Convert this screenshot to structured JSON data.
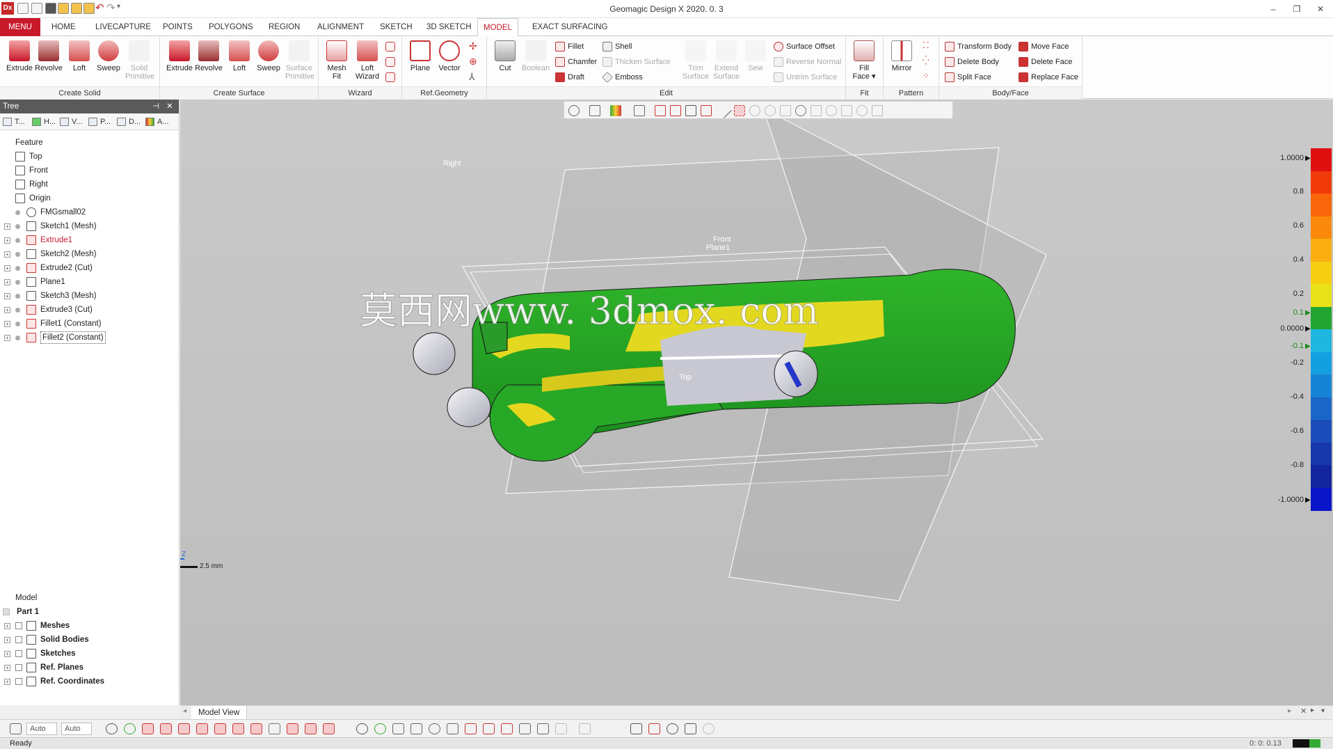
{
  "app": {
    "logo_text": "Dx",
    "window_title": "Geomagic Design X 2020. 0. 3",
    "window_buttons": [
      "–",
      "❐",
      "✕"
    ]
  },
  "tabs": [
    "MENU",
    "HOME",
    "LIVECAPTURE",
    "POINTS",
    "POLYGONS",
    "REGION",
    "ALIGNMENT",
    "SKETCH",
    "3D SKETCH",
    "MODEL",
    "EXACT SURFACING"
  ],
  "active_tab": "MODEL",
  "ribbon": {
    "create_solid": {
      "label": "Create Solid",
      "buttons": [
        "Extrude",
        "Revolve",
        "Loft",
        "Sweep",
        "Solid Primitive"
      ]
    },
    "create_surface": {
      "label": "Create Surface",
      "buttons": [
        "Extrude",
        "Revolve",
        "Loft",
        "Sweep",
        "Surface Primitive"
      ]
    },
    "wizard": {
      "label": "Wizard",
      "buttons": [
        "Mesh Fit",
        "Loft Wizard"
      ]
    },
    "ref_geometry": {
      "label": "Ref.Geometry",
      "buttons": [
        "Plane",
        "Vector"
      ]
    },
    "edit": {
      "label": "Edit",
      "buttons": [
        "Cut",
        "Boolean"
      ],
      "small": [
        "Fillet",
        "Chamfer",
        "Draft",
        "Shell",
        "Thicken Surface",
        "Emboss"
      ],
      "big2": [
        "Trim Surface",
        "Extend Surface",
        "Sew"
      ],
      "small2": [
        "Surface Offset",
        "Reverse Normal",
        "Untrim Surface"
      ]
    },
    "fit": {
      "label": "Fit",
      "buttons": [
        "Fill Face"
      ]
    },
    "pattern": {
      "label": "Pattern",
      "buttons": [
        "Mirror"
      ]
    },
    "body_face": {
      "label": "Body/Face",
      "small": [
        "Transform Body",
        "Delete Body",
        "Split Face",
        "Move Face",
        "Delete Face",
        "Replace Face"
      ]
    }
  },
  "tree": {
    "title": "Tree",
    "tabs": [
      "T...",
      "H...",
      "V...",
      "P...",
      "D...",
      "A..."
    ],
    "feature_header": "Feature",
    "features": [
      {
        "label": "Top",
        "icon": "plane-icon",
        "expandable": false,
        "style": ""
      },
      {
        "label": "Front",
        "icon": "plane-icon",
        "expandable": false,
        "style": ""
      },
      {
        "label": "Right",
        "icon": "plane-icon",
        "expandable": false,
        "style": ""
      },
      {
        "label": "Origin",
        "icon": "origin-icon",
        "expandable": false,
        "style": ""
      },
      {
        "label": "FMGsmall02",
        "icon": "mesh-icon",
        "expandable": false,
        "style": ""
      },
      {
        "label": "Sketch1 (Mesh)",
        "icon": "sketch-icon",
        "expandable": true,
        "style": ""
      },
      {
        "label": "Extrude1",
        "icon": "extrude-icon",
        "expandable": true,
        "style": "red"
      },
      {
        "label": "Sketch2 (Mesh)",
        "icon": "sketch-icon",
        "expandable": true,
        "style": ""
      },
      {
        "label": "Extrude2 (Cut)",
        "icon": "extrude-icon",
        "expandable": true,
        "style": ""
      },
      {
        "label": "Plane1",
        "icon": "plane-icon",
        "expandable": true,
        "style": ""
      },
      {
        "label": "Sketch3 (Mesh)",
        "icon": "sketch-icon",
        "expandable": true,
        "style": ""
      },
      {
        "label": "Extrude3 (Cut)",
        "icon": "extrude-icon",
        "expandable": true,
        "style": ""
      },
      {
        "label": "Fillet1 (Constant)",
        "icon": "fillet-icon",
        "expandable": true,
        "style": ""
      },
      {
        "label": "Fillet2 (Constant)",
        "icon": "fillet-icon",
        "expandable": true,
        "style": "sel"
      }
    ],
    "model_header": "Model",
    "model_root": "Part 1",
    "model_items": [
      "Meshes",
      "Solid Bodies",
      "Sketches",
      "Ref. Planes",
      "Ref. Coordinates"
    ]
  },
  "viewport": {
    "plane_labels": {
      "right": "Right",
      "front": "Front",
      "plane1": "Plane1",
      "top": "Top"
    },
    "watermark": "莫西网www. 3dmox. com",
    "scale_bar": "2.5 mm",
    "axis_labels": {
      "x": "X",
      "z": "Z"
    }
  },
  "color_scale": {
    "labels": [
      "1.0000",
      "0.8",
      "0.6",
      "0.4",
      "0.2",
      "0.1",
      "0.0000",
      "-0.1",
      "-0.2",
      "-0.4",
      "-0.6",
      "-0.8",
      "-1.0000"
    ],
    "colors": [
      "#e01010",
      "#f03a0a",
      "#f8650a",
      "#fb8a0c",
      "#fbae10",
      "#f6cf12",
      "#e8e21a",
      "#22a531",
      "#1eb7e0",
      "#14a0e0",
      "#1684d6",
      "#1a66c8",
      "#1a4cba",
      "#1638ac",
      "#12259e",
      "#0a14c8"
    ]
  },
  "view_tab": "Model View",
  "bottom_toolbar": {
    "combo1": "Auto",
    "combo2": "Auto"
  },
  "status": {
    "left": "Ready",
    "right": "0: 0: 0.13"
  }
}
